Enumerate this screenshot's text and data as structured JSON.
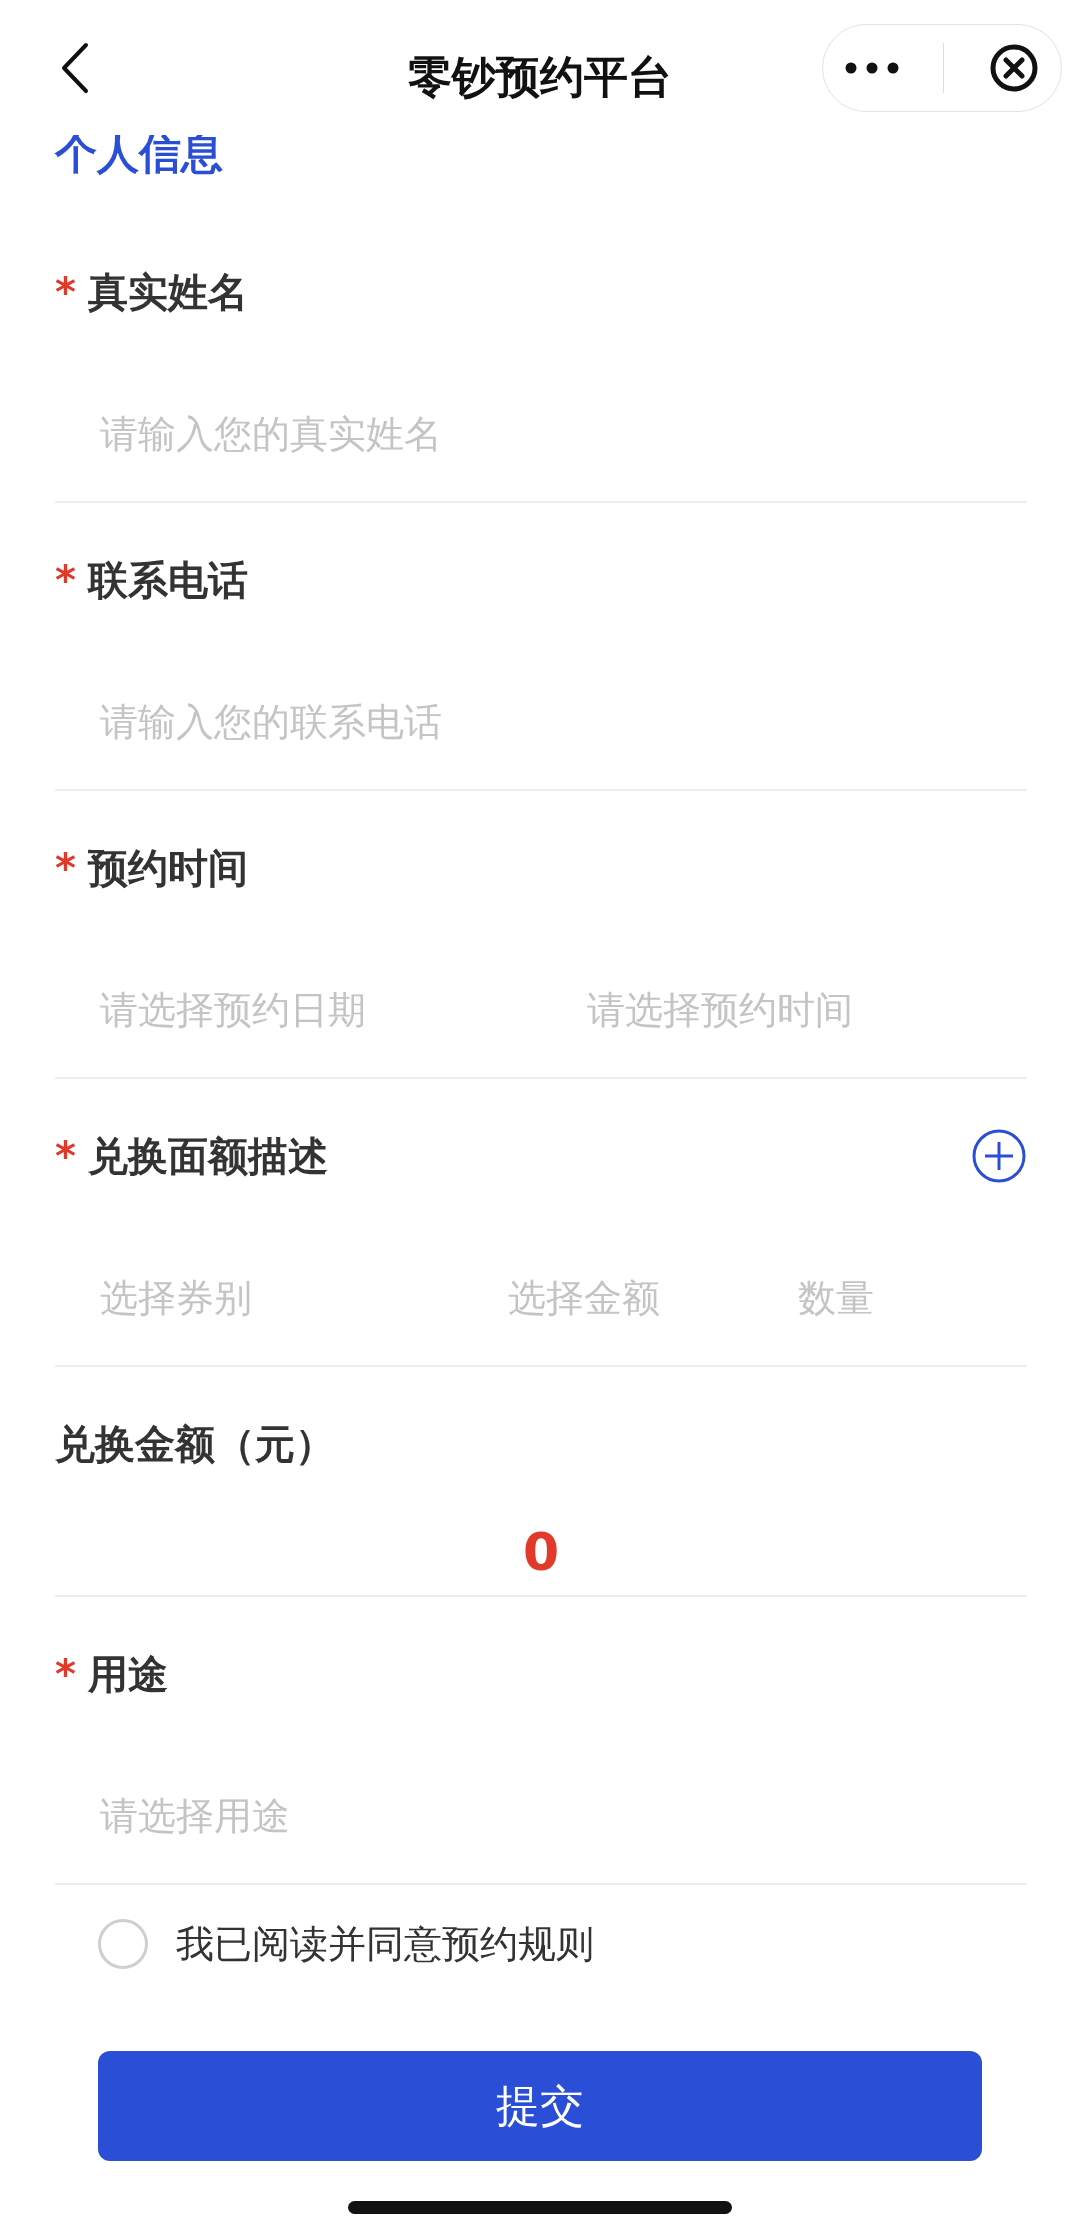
{
  "header": {
    "title": "零钞预约平台"
  },
  "section_title": "个人信息",
  "fields": [
    {
      "kind": "text",
      "marker": "*",
      "label": "真实姓名",
      "placeholders": [
        "请输入您的真实姓名"
      ]
    },
    {
      "kind": "text",
      "marker": "*",
      "label": "联系电话",
      "placeholders": [
        "请输入您的联系电话"
      ]
    },
    {
      "kind": "pair",
      "marker": "*",
      "label": "预约时间",
      "placeholders": [
        "请选择预约日期",
        "请选择预约时间"
      ]
    },
    {
      "kind": "denomination",
      "marker": "*",
      "label": "兑换面额描述",
      "placeholders": [
        "选择券别",
        "选择金额",
        "数量"
      ]
    },
    {
      "kind": "amount",
      "label": "兑换金额（元）",
      "value": "0"
    },
    {
      "kind": "text",
      "marker": "*",
      "label": "用途",
      "placeholders": [
        "请选择用途"
      ]
    }
  ],
  "agreement": {
    "label": "我已阅读并同意预约规则",
    "checked": false
  },
  "submit": "提交"
}
